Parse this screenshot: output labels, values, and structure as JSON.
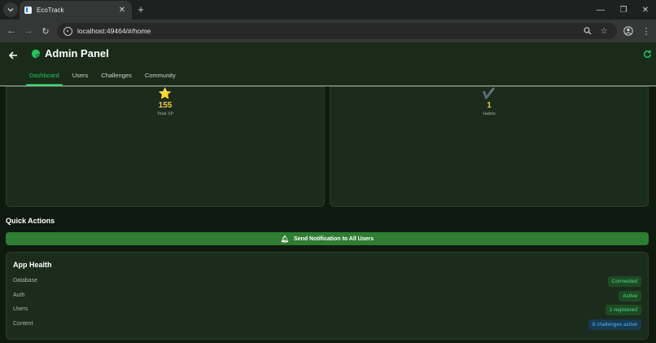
{
  "browser": {
    "tab_title": "EcoTrack",
    "url": "localhost:49464/#/home"
  },
  "app": {
    "title": "Admin Panel",
    "tabs": [
      {
        "label": "Dashboard",
        "active": true
      },
      {
        "label": "Users",
        "active": false
      },
      {
        "label": "Challenges",
        "active": false
      },
      {
        "label": "Community",
        "active": false
      }
    ]
  },
  "stats": [
    {
      "icon": "star-icon",
      "glyph": "⭐",
      "value": "155",
      "label": "Total XP"
    },
    {
      "icon": "check-icon",
      "glyph": "✔️",
      "value": "1",
      "label": "Habits"
    }
  ],
  "quick_actions": {
    "title": "Quick Actions",
    "notify_button": "Send Notification to All Users"
  },
  "app_health": {
    "title": "App Health",
    "rows": [
      {
        "label": "Database",
        "status": "Connected",
        "color": "green"
      },
      {
        "label": "Auth",
        "status": "Active",
        "color": "green"
      },
      {
        "label": "Users",
        "status": "1 registered",
        "color": "green"
      },
      {
        "label": "Content",
        "status": "8 challenges active",
        "color": "blue"
      }
    ]
  },
  "colors": {
    "accent": "#22c55e",
    "button": "#2e7d32",
    "value": "#f5c542"
  }
}
